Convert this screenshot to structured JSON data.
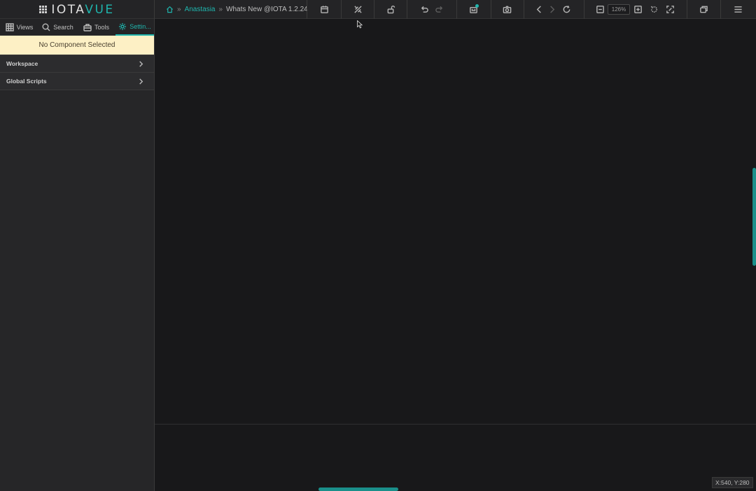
{
  "app": {
    "logo_left": "IOTA",
    "logo_right": "VUE"
  },
  "breadcrumb": {
    "items": [
      "Anastasia",
      "Whats New @IOTA 1.2.24"
    ]
  },
  "toolbar": {
    "zoom_value": "126%",
    "icons": [
      "calendar-icon",
      "tools-icon",
      "unlock-icon",
      "undo-icon",
      "redo-icon",
      "archive-icon",
      "camera-icon",
      "back-icon",
      "forward-icon",
      "refresh-icon",
      "zoom-out-icon",
      "zoom-in-icon",
      "reset-zoom-icon",
      "fit-screen-icon",
      "window-icon",
      "menu-icon"
    ]
  },
  "sidebar": {
    "tabs": [
      {
        "label": "Views",
        "icon": "grid-icon"
      },
      {
        "label": "Search",
        "icon": "search-icon"
      },
      {
        "label": "Tools",
        "icon": "toolbox-icon"
      },
      {
        "label": "Settin...",
        "icon": "gear-icon",
        "active": true
      }
    ],
    "notice": "No Component Selected",
    "sections": [
      {
        "label": "Workspace"
      },
      {
        "label": "Global Scripts"
      }
    ]
  },
  "canvas": {
    "coords": "X:540, Y:280"
  },
  "colors": {
    "accent": "#1fb5ad",
    "notice_bg": "#fdf0c5",
    "bg": "#18181a"
  }
}
